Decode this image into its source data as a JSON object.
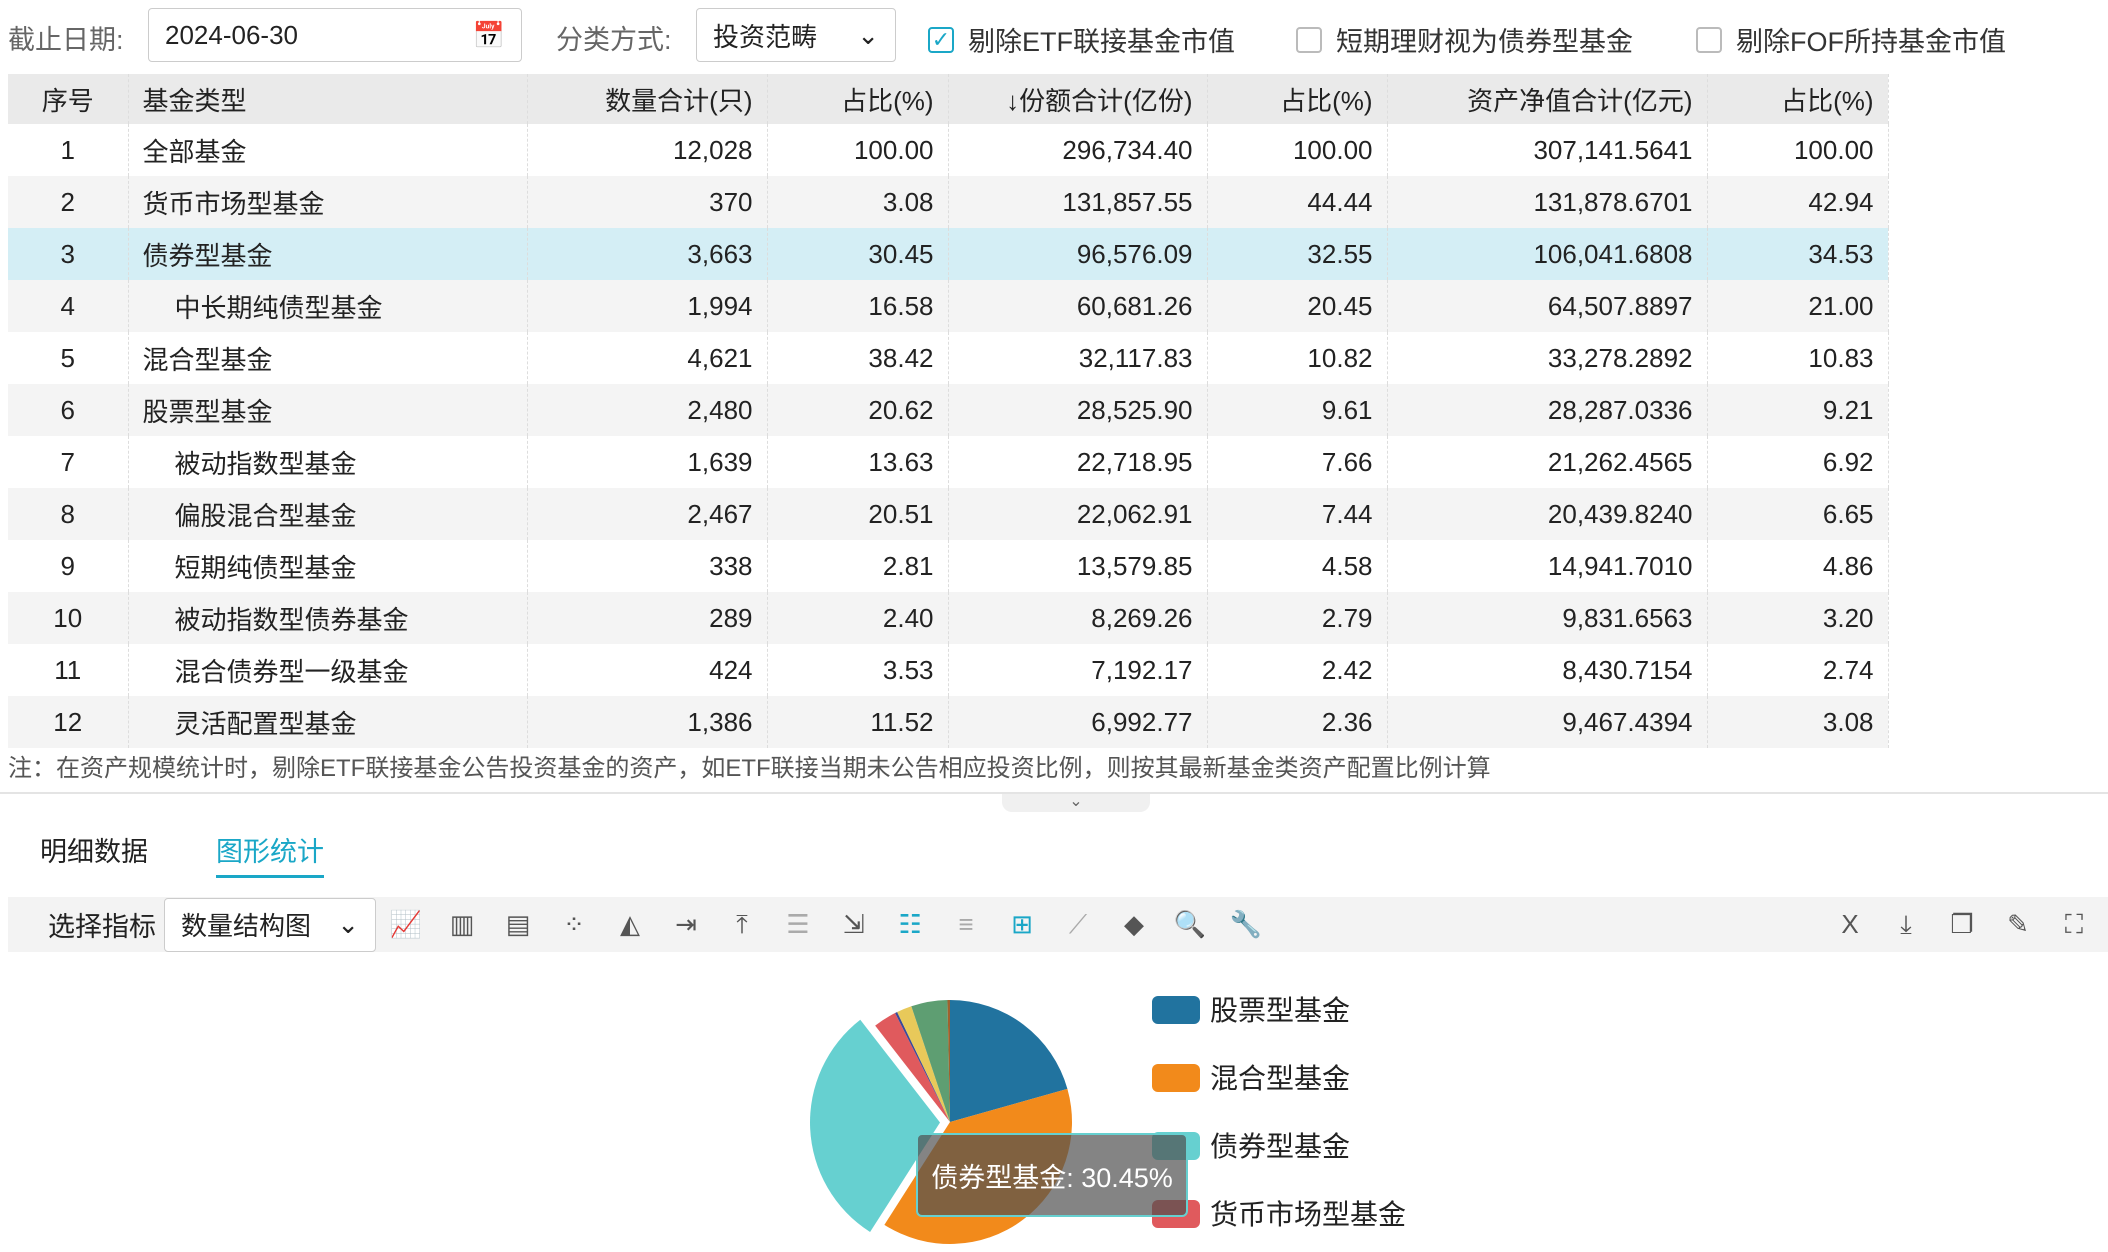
{
  "filters": {
    "date_label": "截止日期:",
    "date_value": "2024-06-30",
    "class_label": "分类方式:",
    "class_value": "投资范畴",
    "checkboxes": [
      {
        "label": "剔除ETF联接基金市值",
        "checked": true
      },
      {
        "label": "短期理财视为债券型基金",
        "checked": false
      },
      {
        "label": "剔除FOF所持基金市值",
        "checked": false
      }
    ]
  },
  "table": {
    "headers": [
      "序号",
      "基金类型",
      "数量合计(只)",
      "占比(%)",
      "↓份额合计(亿份)",
      "占比(%)",
      "资产净值合计(亿元)",
      "占比(%)"
    ],
    "rows": [
      [
        "1",
        "全部基金",
        "12,028",
        "100.00",
        "296,734.40",
        "100.00",
        "307,141.5641",
        "100.00"
      ],
      [
        "2",
        "货币市场型基金",
        "370",
        "3.08",
        "131,857.55",
        "44.44",
        "131,878.6701",
        "42.94"
      ],
      [
        "3",
        "债券型基金",
        "3,663",
        "30.45",
        "96,576.09",
        "32.55",
        "106,041.6808",
        "34.53"
      ],
      [
        "4",
        "中长期纯债型基金",
        "1,994",
        "16.58",
        "60,681.26",
        "20.45",
        "64,507.8897",
        "21.00"
      ],
      [
        "5",
        "混合型基金",
        "4,621",
        "38.42",
        "32,117.83",
        "10.82",
        "33,278.2892",
        "10.83"
      ],
      [
        "6",
        "股票型基金",
        "2,480",
        "20.62",
        "28,525.90",
        "9.61",
        "28,287.0336",
        "9.21"
      ],
      [
        "7",
        "被动指数型基金",
        "1,639",
        "13.63",
        "22,718.95",
        "7.66",
        "21,262.4565",
        "6.92"
      ],
      [
        "8",
        "偏股混合型基金",
        "2,467",
        "20.51",
        "22,062.91",
        "7.44",
        "20,439.8240",
        "6.65"
      ],
      [
        "9",
        "短期纯债型基金",
        "338",
        "2.81",
        "13,579.85",
        "4.58",
        "14,941.7010",
        "4.86"
      ],
      [
        "10",
        "被动指数型债券基金",
        "289",
        "2.40",
        "8,269.26",
        "2.79",
        "9,831.6563",
        "3.20"
      ],
      [
        "11",
        "混合债券型一级基金",
        "424",
        "3.53",
        "7,192.17",
        "2.42",
        "8,430.7154",
        "2.74"
      ],
      [
        "12",
        "灵活配置型基金",
        "1,386",
        "11.52",
        "6,992.77",
        "2.36",
        "9,467.4394",
        "3.08"
      ]
    ],
    "indented": [
      false,
      false,
      false,
      true,
      false,
      false,
      true,
      true,
      true,
      true,
      true,
      true
    ],
    "selected_row": 2
  },
  "note": "注：在资产规模统计时，剔除ETF联接基金公告投资基金的资产，如ETF联接当期未公告相应投资比例，则按其最新基金类资产配置比例计算",
  "tabs": [
    {
      "label": "明细数据",
      "active": false
    },
    {
      "label": "图形统计",
      "active": true
    }
  ],
  "toolbar": {
    "indicator_label": "选择指标",
    "indicator_value": "数量结构图",
    "icons": [
      "line-chart-icon",
      "bar-chart-icon",
      "stacked-bar-icon",
      "scatter-icon",
      "area-chart-icon",
      "align-right-icon",
      "align-top-icon",
      "align-center-icon",
      "align-end-icon",
      "list-icon",
      "rows-icon",
      "crosshair-icon",
      "axis-icon",
      "fill-icon",
      "zoom-icon",
      "wrench-icon"
    ],
    "right_icons": [
      "export-xls-icon",
      "download-icon",
      "copy-icon",
      "edit-icon",
      "fullscreen-icon"
    ]
  },
  "chart_data": {
    "type": "pie",
    "slices": [
      {
        "name": "股票型基金",
        "value": 20.62,
        "color": "#21739f"
      },
      {
        "name": "混合型基金",
        "value": 38.42,
        "color": "#f28a1b"
      },
      {
        "name": "债券型基金",
        "value": 30.45,
        "color": "#66d0d0"
      },
      {
        "name": "货币市场型基金",
        "value": 3.08,
        "color": "#e05a5d"
      },
      {
        "value": 0.3,
        "color": "#3a4a9a"
      },
      {
        "value": 2.0,
        "color": "#e8c95a"
      },
      {
        "value": 4.8,
        "color": "#5e9e72"
      },
      {
        "value": 0.33,
        "color": "#a0622e"
      }
    ],
    "legend": [
      "股票型基金",
      "混合型基金",
      "债券型基金",
      "货币市场型基金"
    ],
    "legend_placement": "right",
    "tooltip": "债券型基金: 30.45%",
    "highlighted": "债券型基金"
  }
}
